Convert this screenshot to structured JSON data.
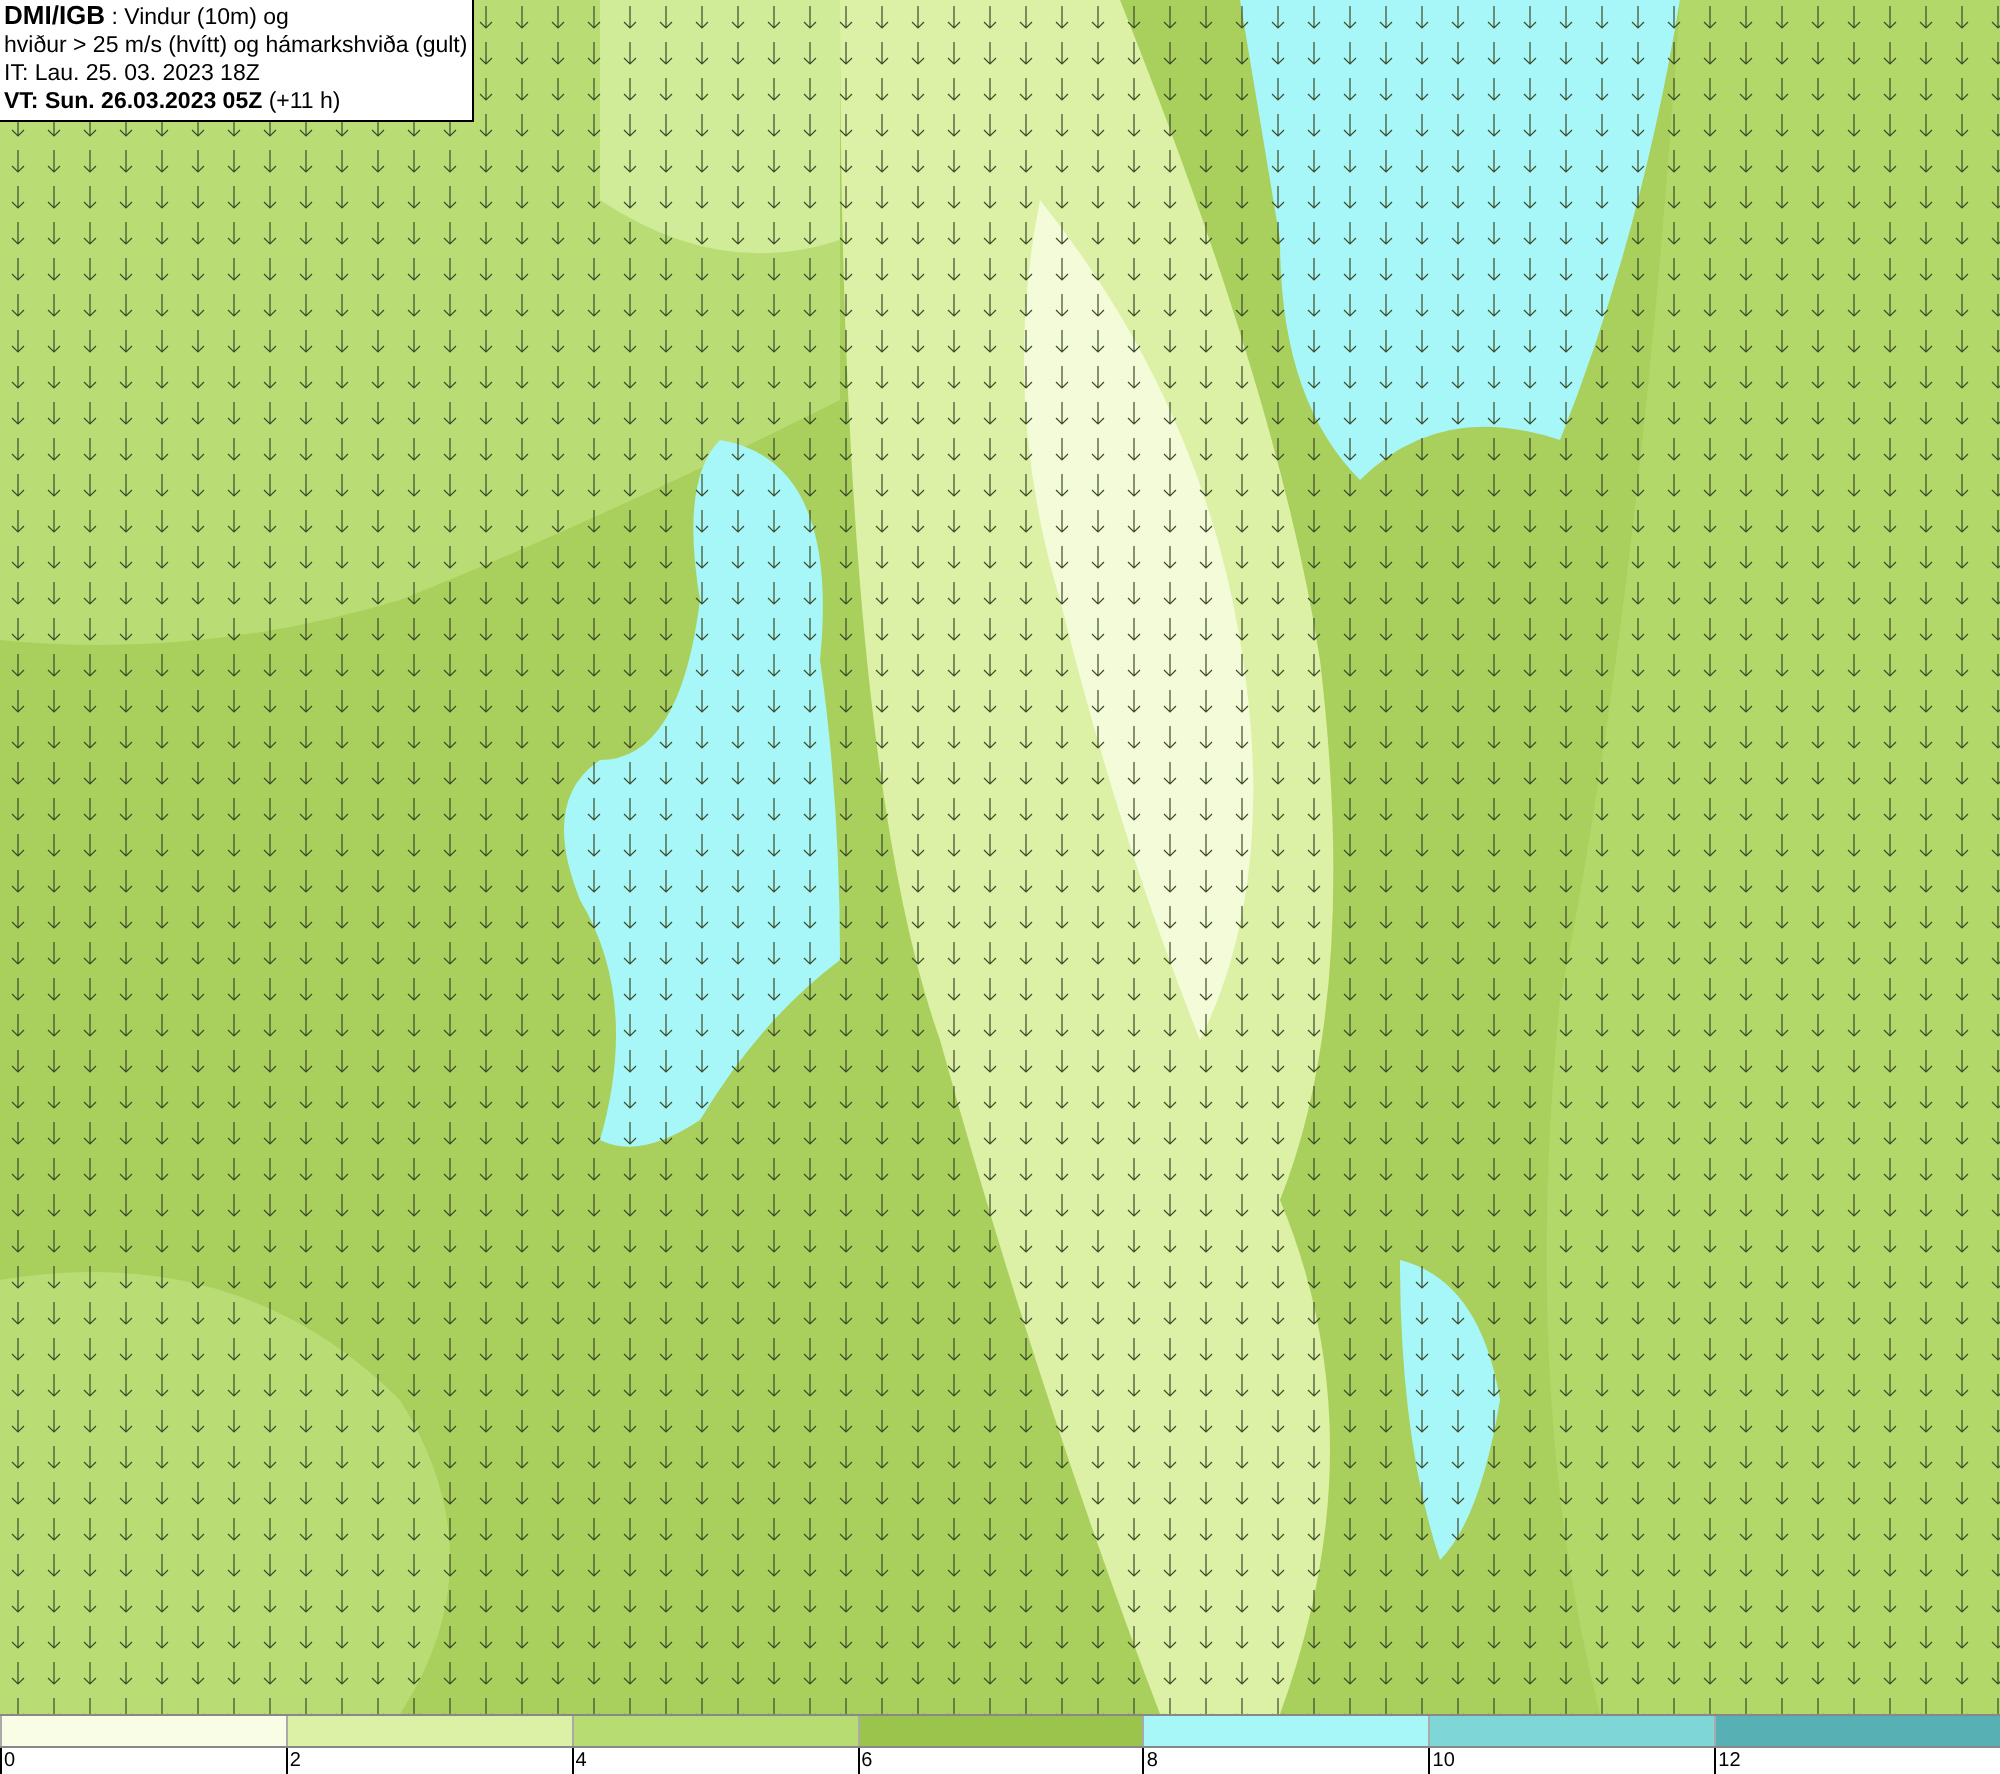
{
  "header": {
    "lines": [
      "**DMI/IGB** : Vindur (10m) og",
      "hviður > 25 m/s (hvítt) og hámarkshviða (gult)",
      "IT: Lau. 25. 03. 2023 18Z",
      "**VT: Sun. 26.03.2023 05Z** (+11 h)"
    ]
  },
  "legend": {
    "swatches": [
      {
        "color": "#fafde6"
      },
      {
        "color": "#dcf1a5"
      },
      {
        "color": "#b7dc72"
      },
      {
        "color": "#9ac44b"
      },
      {
        "color": "#a8f7f8"
      },
      {
        "color": "#7ed7d6"
      },
      {
        "color": "#57b1b4"
      }
    ],
    "ticks": [
      "0",
      "2",
      "4",
      "6",
      "8",
      "10",
      "12"
    ]
  }
}
